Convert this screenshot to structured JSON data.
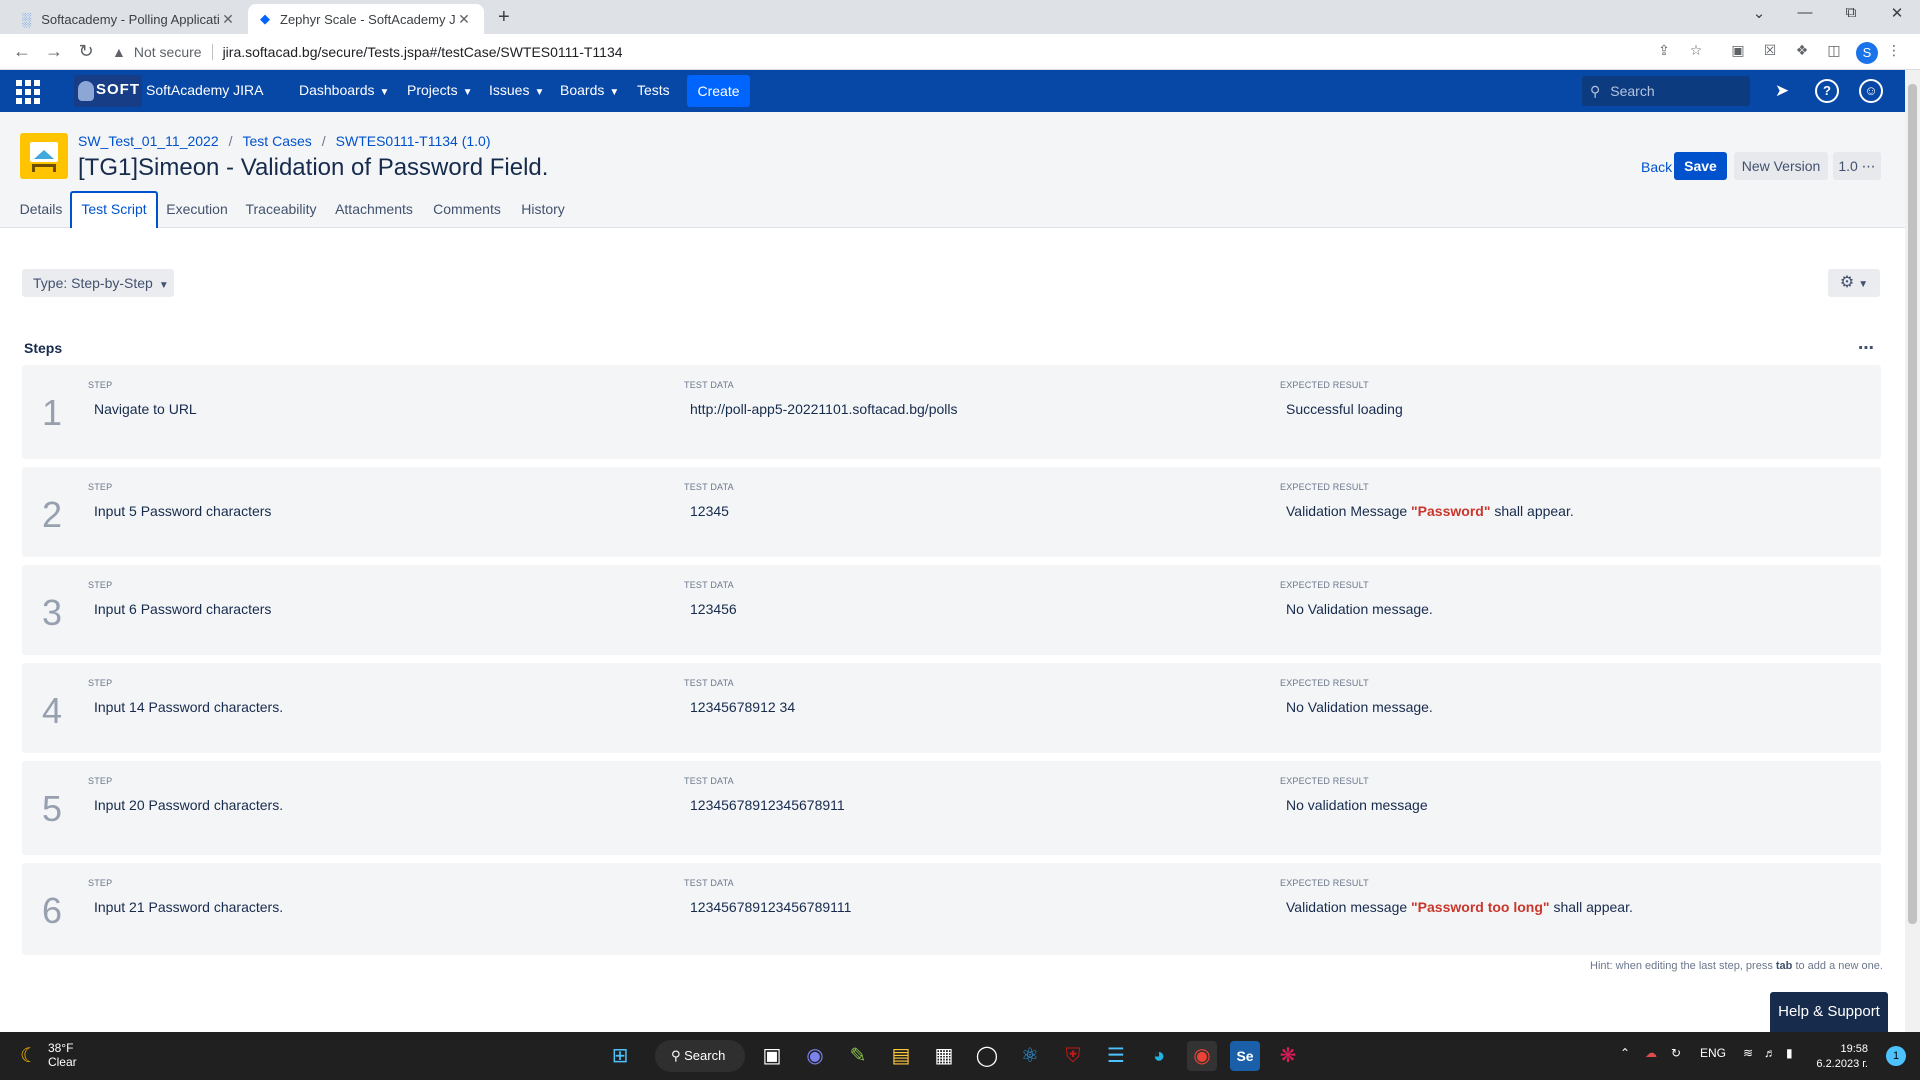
{
  "browser": {
    "tabs": [
      {
        "title": "Softacademy - Polling Applicatio",
        "icon": "bar-chart-icon"
      },
      {
        "title": "Zephyr Scale - SoftAcademy JIRA",
        "icon": "zephyr-icon"
      }
    ],
    "security_label": "Not secure",
    "url": "jira.softacad.bg/secure/Tests.jspa#/testCase/SWTES0111-T1134",
    "profile_initial": "S"
  },
  "header": {
    "logo_text": "SOFT",
    "brand": "SoftAcademy JIRA",
    "nav": [
      "Dashboards",
      "Projects",
      "Issues",
      "Boards",
      "Tests"
    ],
    "create_label": "Create",
    "search_placeholder": "Search"
  },
  "page": {
    "breadcrumbs": [
      "SW_Test_01_11_2022",
      "Test Cases",
      "SWTES0111-T1134 (1.0)"
    ],
    "title": "[TG1]Simeon - Validation of Password Field.",
    "back_label": "Back",
    "save_label": "Save",
    "new_version_label": "New Version",
    "version_label": "1.0 ⋯",
    "tabs": [
      "Details",
      "Test Script",
      "Execution",
      "Traceability",
      "Attachments",
      "Comments",
      "History"
    ],
    "active_tab": "Test Script",
    "type_label": "Type: Step-by-Step",
    "steps_heading": "Steps",
    "column_labels": {
      "step": "STEP",
      "test_data": "TEST DATA",
      "expected": "EXPECTED RESULT"
    },
    "steps": [
      {
        "num": "1",
        "step": "Navigate to URL",
        "data": "http://poll-app5-20221101.softacad.bg/polls",
        "expected_pre": "Successful loading",
        "expected_hl": "",
        "expected_post": ""
      },
      {
        "num": "2",
        "step": "Input 5 Password characters",
        "data": "12345",
        "expected_pre": "Validation Message ",
        "expected_hl": "\"Password\"",
        "expected_post": " shall appear."
      },
      {
        "num": "3",
        "step": "Input 6 Password characters",
        "data": "123456",
        "expected_pre": "No Validation message.",
        "expected_hl": "",
        "expected_post": ""
      },
      {
        "num": "4",
        "step": "Input 14 Password characters.",
        "data": "12345678912 34",
        "expected_pre": "No Validation message.",
        "expected_hl": "",
        "expected_post": ""
      },
      {
        "num": "5",
        "step": "Input 20 Password characters.",
        "data": "12345678912345678911",
        "expected_pre": "No validation message",
        "expected_hl": "",
        "expected_post": ""
      },
      {
        "num": "6",
        "step": "Input 21 Password characters.",
        "data": "123456789123456789111",
        "expected_pre": "Validation message ",
        "expected_hl": "\"Password too long\"",
        "expected_post": " shall appear."
      }
    ],
    "hint_pre": "Hint: when editing the last step, press ",
    "hint_key": "tab",
    "hint_post": " to add a new one.",
    "help_label": "Help & Support"
  },
  "taskbar": {
    "temperature": "38°F",
    "condition": "Clear",
    "search_label": "Search",
    "language": "ENG",
    "time": "19:58",
    "date": "6.2.2023 г.",
    "notification_count": "1"
  },
  "colors": {
    "header_bg": "#0747a6",
    "accent": "#0052cc",
    "highlight_red": "#c9372c",
    "project_icon": "#ffc400"
  }
}
